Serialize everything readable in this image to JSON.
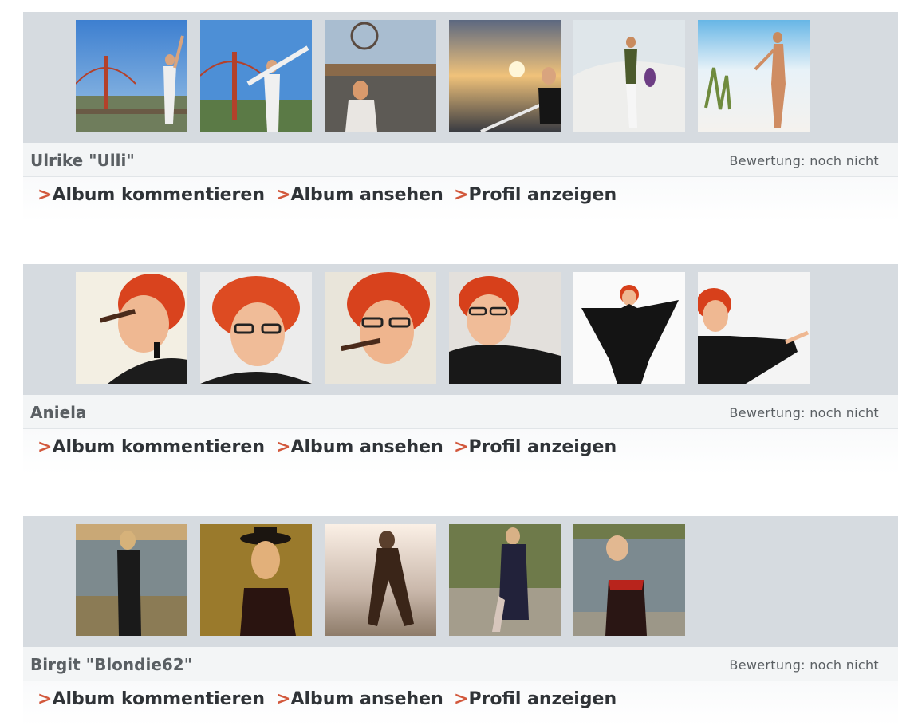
{
  "albums": [
    {
      "name": "Ulrike \"Ulli\"",
      "rating": "Bewertung: noch nicht",
      "links": {
        "comment": "Album kommentieren",
        "view": "Album ansehen",
        "profile": "Profil anzeigen"
      },
      "arrow": ">",
      "photos": [
        "golden-gate-photo-1",
        "golden-gate-photo-2",
        "pier-ferris-wheel-photo",
        "sunset-railing-photo",
        "white-rocks-photo",
        "beach-dunes-photo"
      ]
    },
    {
      "name": "Aniela",
      "rating": "Bewertung: noch nicht",
      "links": {
        "comment": "Album kommentieren",
        "view": "Album ansehen",
        "profile": "Profil anzeigen"
      },
      "arrow": ">",
      "photos": [
        "cigar-portrait-photo-1",
        "glasses-portrait-photo",
        "cigar-portrait-photo-2",
        "laughing-portrait-photo",
        "black-dress-arms-photo",
        "side-pose-photo"
      ]
    },
    {
      "name": "Birgit \"Blondie62\"",
      "rating": "Bewertung: noch nicht",
      "links": {
        "comment": "Album kommentieren",
        "view": "Album ansehen",
        "profile": "Profil anzeigen"
      },
      "arrow": ">",
      "photos": [
        "lakeside-photo",
        "hat-portrait-photo",
        "backlit-pose-photo",
        "coat-outdoor-photo",
        "riverside-dress-photo"
      ]
    }
  ],
  "colors": {
    "strip": "#d6dbe0",
    "arrow": "#d2583c",
    "link": "#2f3337",
    "name": "#5a5f63"
  }
}
